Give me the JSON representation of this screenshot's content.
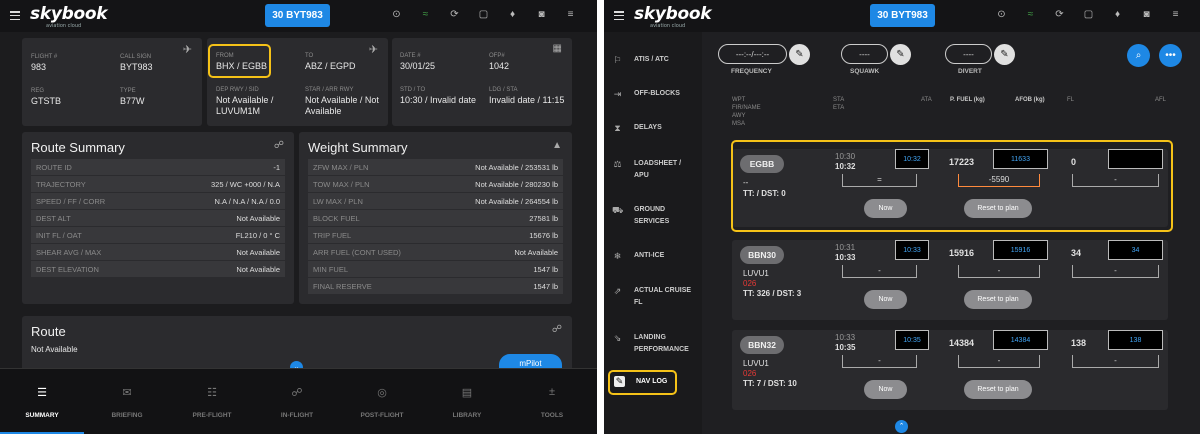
{
  "app": {
    "logo": "skybook",
    "tagline": "aviation cloud",
    "flight_button": "30 BYT983"
  },
  "summary": {
    "flight_info": [
      {
        "label": "FLIGHT #",
        "value": "983"
      },
      {
        "label": "CALL SIGN",
        "value": "BYT983"
      },
      {
        "label": "FROM",
        "value": "BHX / EGBB"
      },
      {
        "label": "TO",
        "value": "ABZ / EGPD"
      },
      {
        "label": "DATE #",
        "value": "30/01/25"
      },
      {
        "label": "OFP#",
        "value": "1042"
      },
      {
        "label": "REG",
        "value": "GTSTB"
      },
      {
        "label": "TYPE",
        "value": "B77W"
      },
      {
        "label": "DEP RWY / SID",
        "value": "Not Available / LUVUM1M"
      },
      {
        "label": "STAR / ARR RWY",
        "value": "Not Available / Not Available"
      },
      {
        "label": "STD / TO",
        "value": "10:30 / Invalid date"
      },
      {
        "label": "LDG / STA",
        "value": "Invalid date / 11:15"
      }
    ],
    "route_summary": {
      "title": "Route Summary",
      "rows": [
        {
          "k": "ROUTE ID",
          "v": "-1"
        },
        {
          "k": "TRAJECTORY",
          "v": "325 / WC +000 / N.A"
        },
        {
          "k": "SPEED / FF / CORR",
          "v": "N.A / N.A / N.A / 0.0"
        },
        {
          "k": "DEST ALT",
          "v": "Not Available"
        },
        {
          "k": "INIT FL / OAT",
          "v": "FL210 / 0 ° C"
        },
        {
          "k": "SHEAR AVG / MAX",
          "v": "Not Available"
        },
        {
          "k": "DEST ELEVATION",
          "v": "Not Available"
        }
      ]
    },
    "weight_summary": {
      "title": "Weight Summary",
      "rows": [
        {
          "k": "ZFW MAX / PLN",
          "v": "Not Available / 253531 lb"
        },
        {
          "k": "TOW MAX / PLN",
          "v": "Not Available / 280230 lb"
        },
        {
          "k": "LW MAX / PLN",
          "v": "Not Available / 264554 lb"
        },
        {
          "k": "BLOCK FUEL",
          "v": "27581 lb"
        },
        {
          "k": "TRIP FUEL",
          "v": "15676 lb"
        },
        {
          "k": "ARR FUEL (CONT USED)",
          "v": "Not Available"
        },
        {
          "k": "MIN FUEL",
          "v": "1547 lb"
        },
        {
          "k": "FINAL RESERVE",
          "v": "1547 lb"
        }
      ]
    },
    "route": {
      "title": "Route",
      "value": "Not Available",
      "button": "mPilot"
    },
    "bottom_nav": [
      "SUMMARY",
      "BRIEFING",
      "PRE-FLIGHT",
      "IN-FLIGHT",
      "POST-FLIGHT",
      "LIBRARY",
      "TOOLS"
    ]
  },
  "navlog": {
    "sidebar": [
      "ATIS / ATC",
      "OFF-BLOCKS",
      "DELAYS",
      "LOADSHEET / APU",
      "GROUND SERVICES",
      "ANTI-ICE",
      "ACTUAL CRUISE FL",
      "LANDING PERFORMANCE",
      "NAV LOG"
    ],
    "pills": [
      {
        "value": "---:--/---:--",
        "label": "FREQUENCY"
      },
      {
        "value": "----",
        "label": "SQUAWK"
      },
      {
        "value": "----",
        "label": "DIVERT"
      }
    ],
    "headers": {
      "wpt": "WPT",
      "fir": "FIR/NAME",
      "awy": "AWY",
      "msa": "MSA",
      "sta": "STA",
      "eta": "ETA",
      "ata": "ATA",
      "pfuel": "P. FUEL (kg)",
      "afob": "AFOB (kg)",
      "fl": "FL",
      "afl": "AFL"
    },
    "waypoints": [
      {
        "name": "EGBB",
        "l1": "--",
        "l2": "",
        "tt": "TT: / DST: 0",
        "sta": "10:30",
        "eta": "10:32",
        "ata": "10:32",
        "eq": "=",
        "pfuel": "17223",
        "afob": "11633",
        "diff": "-5590",
        "fl": "0",
        "afl": "",
        "afl_sep": "-",
        "now": "Now",
        "reset": "Reset to plan"
      },
      {
        "name": "BBN30",
        "l1": "LUVU1",
        "l2": "026",
        "tt": "TT: 326 / DST: 3",
        "sta": "10:31",
        "eta": "10:33",
        "ata": "10:33",
        "eq": "-",
        "pfuel": "15916",
        "afob": "15916",
        "diff": "-",
        "fl": "34",
        "afl": "34",
        "afl_sep": "-",
        "now": "Now",
        "reset": "Reset to plan"
      },
      {
        "name": "BBN32",
        "l1": "LUVU1",
        "l2": "026",
        "tt": "TT: 7 / DST: 10",
        "sta": "10:33",
        "eta": "10:35",
        "ata": "10:35",
        "eq": "-",
        "pfuel": "14384",
        "afob": "14384",
        "diff": "-",
        "fl": "138",
        "afl": "138",
        "afl_sep": "-",
        "now": "Now",
        "reset": "Reset to plan"
      }
    ]
  },
  "colors": {
    "accent": "#1e88e5",
    "highlight": "#f5c218",
    "alert": "#e53935",
    "active": "#43a047"
  }
}
